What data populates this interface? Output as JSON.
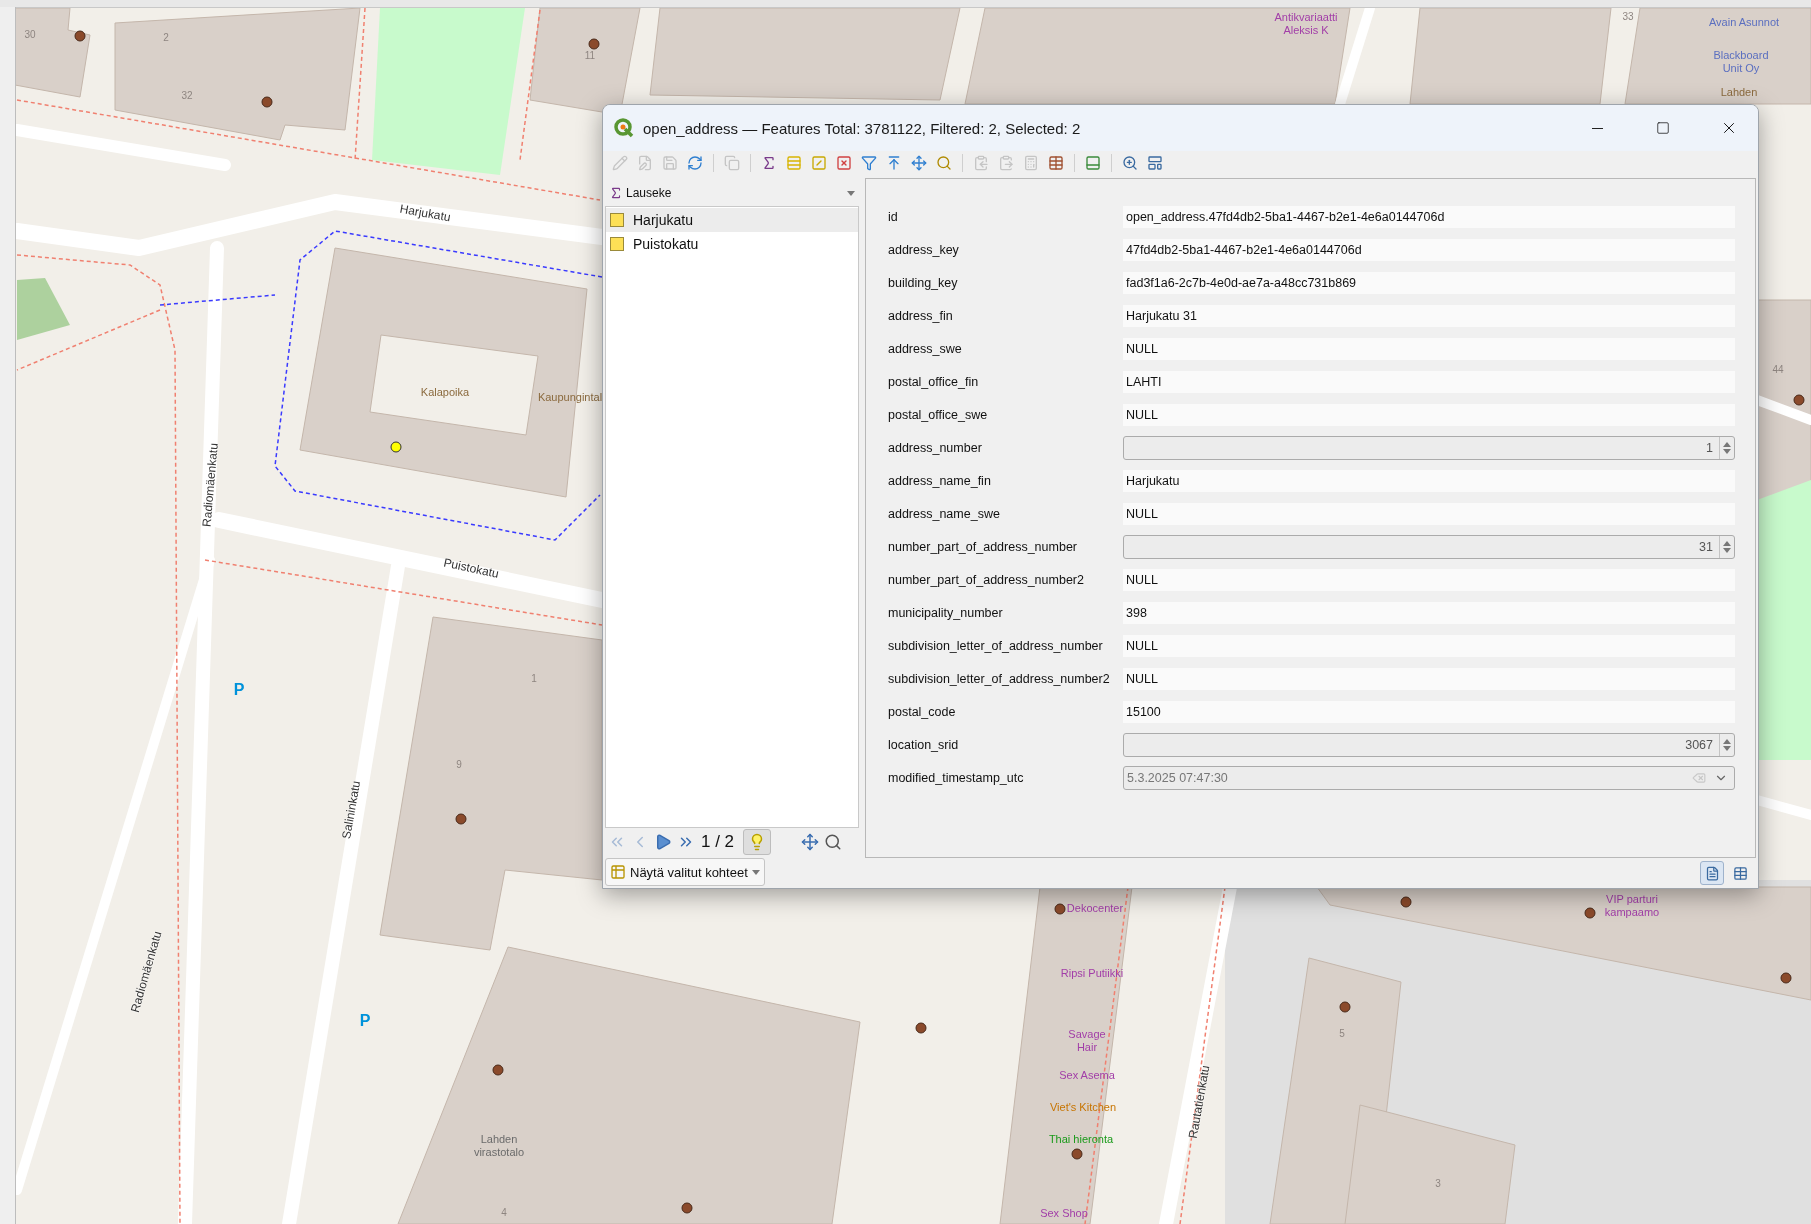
{
  "map": {
    "labels": [
      {
        "text": "Harjukatu",
        "kind": "street"
      },
      {
        "text": "Puistokatu",
        "kind": "street"
      },
      {
        "text": "Radiomäenkatu",
        "kind": "street"
      },
      {
        "text": "Radiomäenkatu",
        "kind": "street"
      },
      {
        "text": "Salininkatu",
        "kind": "street"
      },
      {
        "text": "Rautatienkatu",
        "kind": "street"
      },
      {
        "text": "Kalapoika",
        "kind": "poi",
        "color": "#8b6a3e"
      },
      {
        "text": "Kaupungintal",
        "kind": "poi",
        "color": "#8b6a3e"
      },
      {
        "text": "Lahden virastotalo",
        "kind": "poi",
        "color": "#6b6b6b"
      },
      {
        "text": "Antikvariaatti Aleksis K",
        "kind": "poi",
        "color": "#a23ea8"
      },
      {
        "text": "Avain Asunnot",
        "kind": "poi",
        "color": "#5b6fc0"
      },
      {
        "text": "Blackboard Unit Oy",
        "kind": "poi",
        "color": "#5b6fc0"
      },
      {
        "text": "Lahden",
        "kind": "poi",
        "color": "#8b6a3e"
      },
      {
        "text": "Dekocenter",
        "kind": "poi",
        "color": "#a23ea8"
      },
      {
        "text": "VIP parturi kampaamo",
        "kind": "poi",
        "color": "#a23ea8"
      },
      {
        "text": "Ripsi Putiikki",
        "kind": "poi",
        "color": "#a23ea8"
      },
      {
        "text": "Savage Hair",
        "kind": "poi",
        "color": "#a23ea8"
      },
      {
        "text": "Sex Asema",
        "kind": "poi",
        "color": "#a23ea8"
      },
      {
        "text": "Viet's Kitchen",
        "kind": "poi",
        "color": "#c77400"
      },
      {
        "text": "Thai hieronta",
        "kind": "poi",
        "color": "#1a9a1a"
      },
      {
        "text": "Sex Shop",
        "kind": "poi",
        "color": "#a23ea8"
      },
      {
        "text": "30",
        "kind": "number"
      },
      {
        "text": "2",
        "kind": "number"
      },
      {
        "text": "32",
        "kind": "number"
      },
      {
        "text": "11",
        "kind": "number"
      },
      {
        "text": "33",
        "kind": "number"
      },
      {
        "text": "1",
        "kind": "number"
      },
      {
        "text": "9",
        "kind": "number"
      },
      {
        "text": "5",
        "kind": "number"
      },
      {
        "text": "3",
        "kind": "number"
      },
      {
        "text": "4",
        "kind": "number"
      },
      {
        "text": "44",
        "kind": "number"
      },
      {
        "text": "P",
        "kind": "parking"
      },
      {
        "text": "P",
        "kind": "parking"
      }
    ]
  },
  "dialog": {
    "title": "open_address — Features Total: 3781122, Filtered: 2, Selected: 2",
    "toolbar": [
      {
        "kind": "pencil",
        "disabled": true
      },
      {
        "kind": "multi-edit",
        "disabled": true
      },
      {
        "kind": "save",
        "disabled": true
      },
      {
        "kind": "refresh",
        "disabled": false
      },
      {
        "kind": "copy",
        "disabled": true
      },
      {
        "kind": "select-expression",
        "disabled": false
      },
      {
        "kind": "select-all",
        "disabled": false
      },
      {
        "kind": "invert",
        "disabled": false
      },
      {
        "kind": "deselect",
        "disabled": false
      },
      {
        "kind": "filter",
        "disabled": false
      },
      {
        "kind": "move-top",
        "disabled": false
      },
      {
        "kind": "pan",
        "disabled": false
      },
      {
        "kind": "zoom",
        "disabled": false
      },
      {
        "kind": "copy-cells",
        "disabled": true
      },
      {
        "kind": "paste",
        "disabled": true
      },
      {
        "kind": "field-calc",
        "disabled": true
      },
      {
        "kind": "conditional",
        "disabled": false
      },
      {
        "kind": "dock",
        "disabled": false
      },
      {
        "kind": "actions",
        "disabled": false
      },
      {
        "kind": "form",
        "disabled": false
      }
    ],
    "expression": {
      "label": "Lauseke"
    },
    "features": [
      {
        "label": "Harjukatu",
        "selected": true
      },
      {
        "label": "Puistokatu",
        "selected": false
      }
    ],
    "navigation": {
      "buttons": [
        {
          "kind": "first",
          "disabled": true
        },
        {
          "kind": "prev",
          "disabled": true
        },
        {
          "kind": "next",
          "disabled": false
        },
        {
          "kind": "last",
          "disabled": false
        }
      ],
      "counter": "1 / 2",
      "highlight_on": true
    },
    "show_button": "Näytä valitut kohteet",
    "fields": [
      {
        "name": "id",
        "value": "open_address.47fd4db2-5ba1-4467-b2e1-4e6a0144706d",
        "kind": "text"
      },
      {
        "name": "address_key",
        "value": "47fd4db2-5ba1-4467-b2e1-4e6a0144706d",
        "kind": "text"
      },
      {
        "name": "building_key",
        "value": "fad3f1a6-2c7b-4e0d-ae7a-a48cc731b869",
        "kind": "text"
      },
      {
        "name": "address_fin",
        "value": "Harjukatu 31",
        "kind": "text"
      },
      {
        "name": "address_swe",
        "value": "NULL",
        "kind": "text"
      },
      {
        "name": "postal_office_fin",
        "value": "LAHTI",
        "kind": "text"
      },
      {
        "name": "postal_office_swe",
        "value": "NULL",
        "kind": "text"
      },
      {
        "name": "address_number",
        "value": "1",
        "kind": "spin"
      },
      {
        "name": "address_name_fin",
        "value": "Harjukatu",
        "kind": "text"
      },
      {
        "name": "address_name_swe",
        "value": "NULL",
        "kind": "text"
      },
      {
        "name": "number_part_of_address_number",
        "value": "31",
        "kind": "spin"
      },
      {
        "name": "number_part_of_address_number2",
        "value": "NULL",
        "kind": "text"
      },
      {
        "name": "municipality_number",
        "value": "398",
        "kind": "text"
      },
      {
        "name": "subdivision_letter_of_address_number",
        "value": "NULL",
        "kind": "text"
      },
      {
        "name": "subdivision_letter_of_address_number2",
        "value": "NULL",
        "kind": "text"
      },
      {
        "name": "postal_code",
        "value": "15100",
        "kind": "text"
      },
      {
        "name": "location_srid",
        "value": "3067",
        "kind": "spin"
      },
      {
        "name": "modified_timestamp_utc",
        "value": "5.3.2025 07:47:30",
        "kind": "datetime"
      }
    ],
    "views": [
      {
        "kind": "form",
        "selected": true
      },
      {
        "kind": "table",
        "selected": false
      }
    ]
  }
}
